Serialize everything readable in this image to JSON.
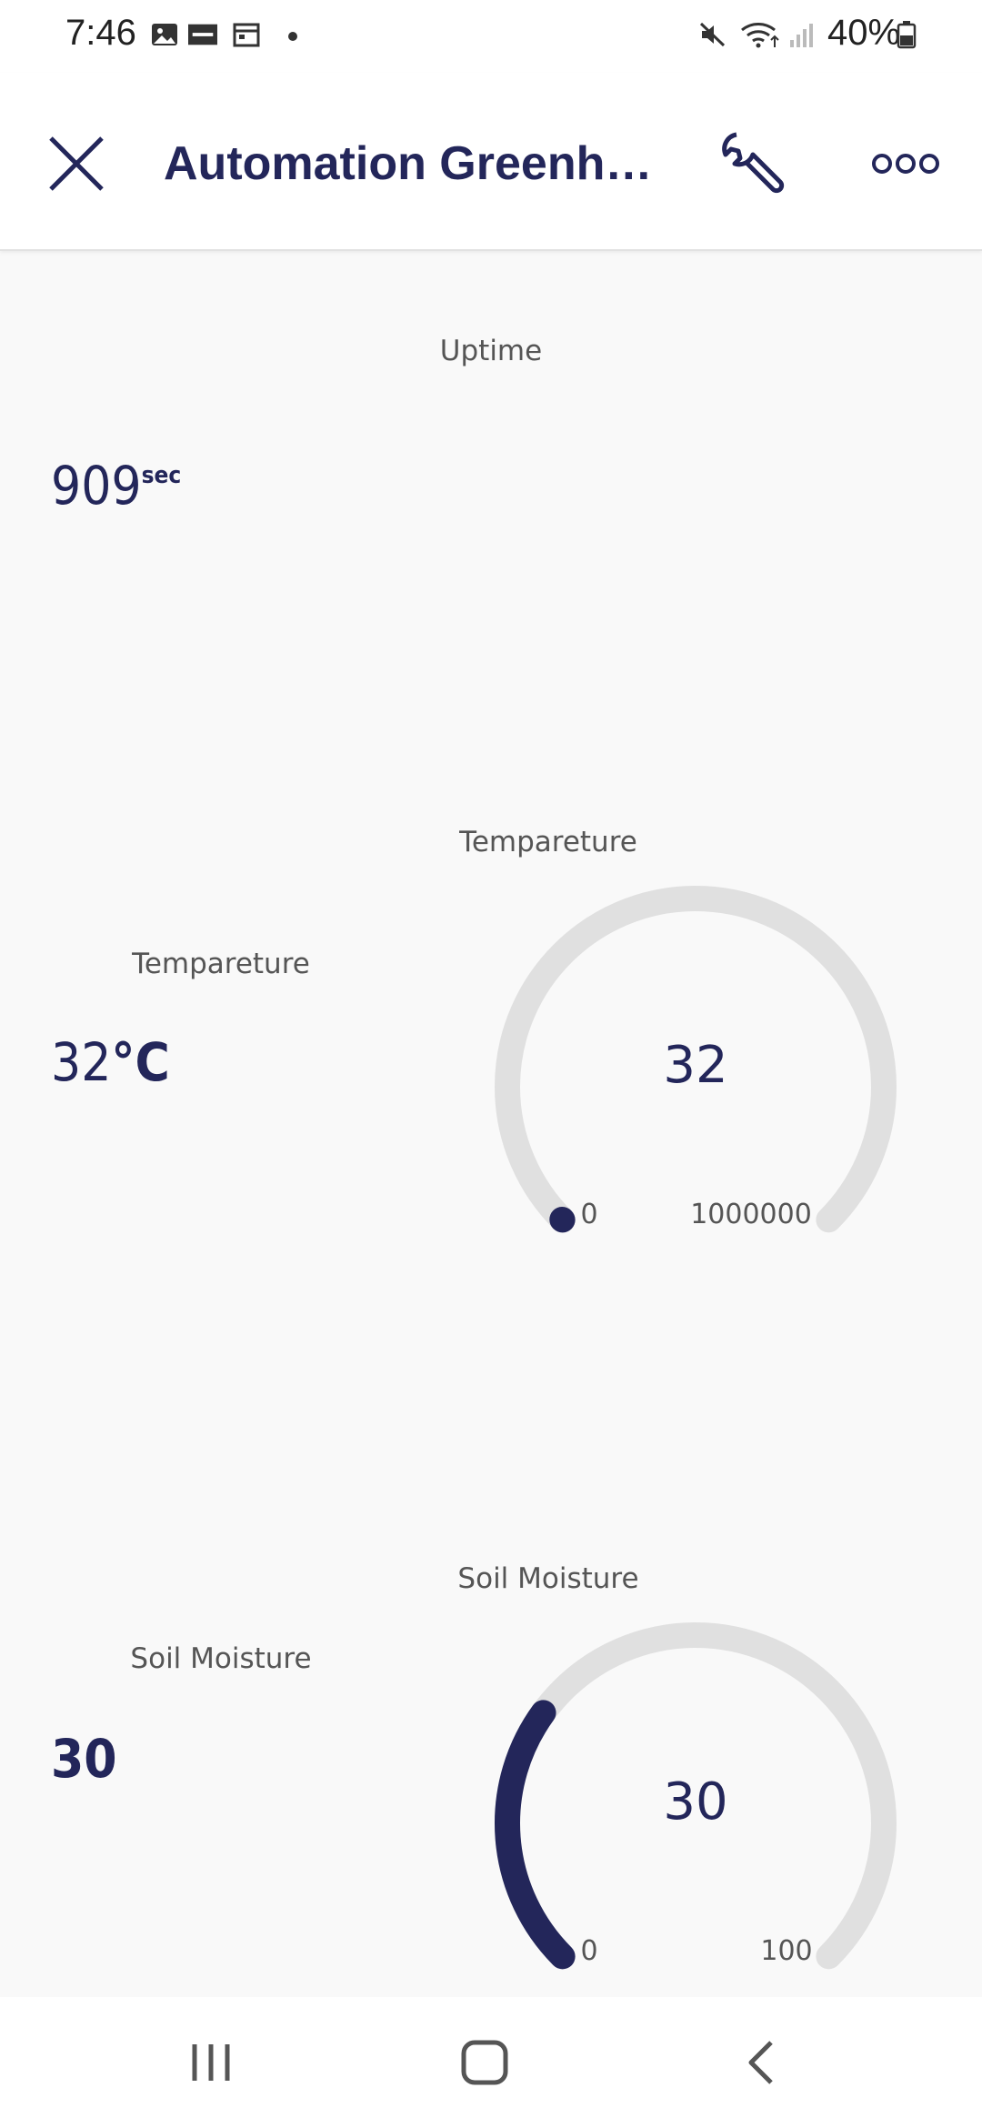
{
  "status_bar": {
    "time": "7:46",
    "battery": "40%",
    "icons": [
      "gallery-icon",
      "zomato-icon",
      "calendar-icon",
      "dot-icon",
      "mute-icon",
      "wifi-icon",
      "signal-icon",
      "battery-icon"
    ]
  },
  "app_bar": {
    "title": "Automation Greenh…",
    "icons": [
      "close-icon",
      "wrench-icon",
      "more-icon"
    ]
  },
  "uptime": {
    "title": "Uptime",
    "value": "909",
    "unit": "sec"
  },
  "temperature_label": {
    "title": "Tempareture",
    "value": "32",
    "unit": "°C"
  },
  "temperature_gauge": {
    "title": "Tempareture",
    "value": "32",
    "min": "0",
    "max": "1000000",
    "level_fraction": 3.2e-05
  },
  "soil_label": {
    "title": "Soil Moisture",
    "value": "30"
  },
  "soil_gauge": {
    "title": "Soil Moisture",
    "value": "30",
    "min": "0",
    "max": "100",
    "level_fraction": 0.3
  },
  "colors": {
    "accent": "#23265a",
    "track": "#e0e0e0",
    "background": "#f9f9f9"
  },
  "nav_bar": {
    "icons": [
      "recent-apps-icon",
      "home-icon",
      "back-icon"
    ]
  }
}
